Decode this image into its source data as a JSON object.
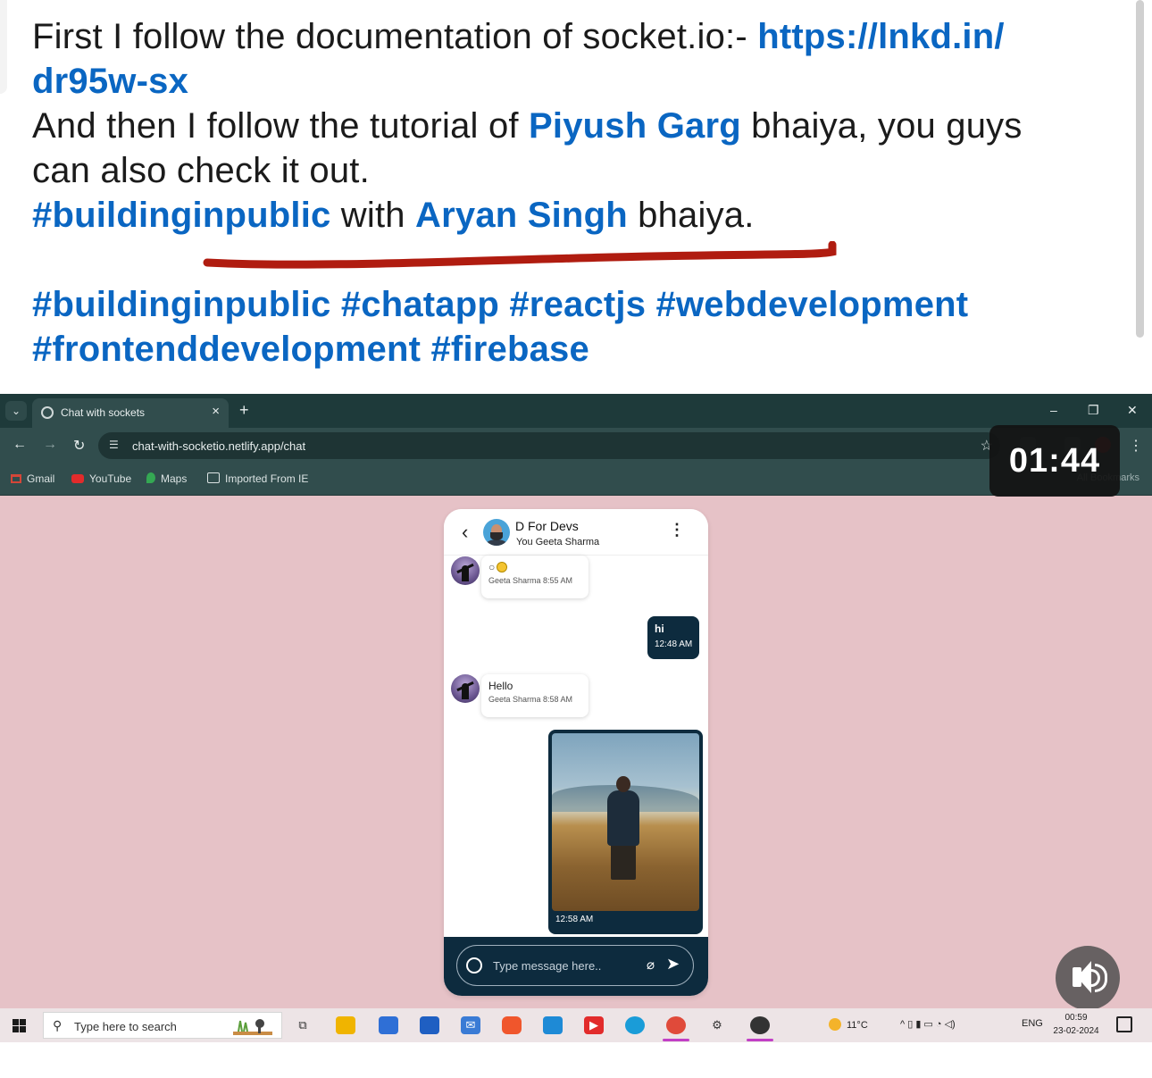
{
  "post": {
    "line1_text": "First I follow the documentation of socket.io:- ",
    "line1_link": "https://lnkd.in/",
    "line2_link": "dr95w-sx",
    "line3_prefix": "And then I follow the tutorial of ",
    "line3_mention": "Piyush Garg",
    "line3_suffix": " bhaiya, you guys",
    "line4_text": "can also check it out.",
    "line5_hashtag": "#buildinginpublic",
    "line5_mid": " with ",
    "line5_mention": "Aryan Singh",
    "line5_suffix": " bhaiya.",
    "hashtags_line1": [
      "#buildinginpublic",
      "#chatapp",
      "#reactjs",
      "#webdevelopment"
    ],
    "hashtags_line2": [
      "#frontenddevelopment",
      "#firebase"
    ],
    "annotation_color": "#b01c10"
  },
  "browser": {
    "tab_title": "Chat with sockets",
    "url": "chat-with-socketio.netlify.app/chat",
    "bookmarks": [
      "Gmail",
      "YouTube",
      "Maps",
      "Imported From IE"
    ],
    "all_bookmarks": "All Bookmarks"
  },
  "video": {
    "timer": "01:44",
    "background_color": "#e6c2c7"
  },
  "chat": {
    "group_name": "D For Devs",
    "members": "You Geeta Sharma",
    "messages": [
      {
        "direction": "in",
        "text": "○",
        "sender": "Geeta Sharma",
        "time": "8:55 AM",
        "meta": "Geeta Sharma 8:55 AM"
      },
      {
        "direction": "out",
        "text": "hi",
        "time": "12:48 AM"
      },
      {
        "direction": "in",
        "text": "Hello",
        "sender": "Geeta Sharma",
        "time": "8:58 AM",
        "meta": "Geeta Sharma 8:58 AM"
      },
      {
        "direction": "out",
        "type": "image",
        "time": "12:58 AM"
      }
    ],
    "input_placeholder": "Type message here..",
    "accent_color": "#0d2b3e"
  },
  "taskbar": {
    "search_placeholder": "Type here to search",
    "weather": "11°C",
    "language": "ENG",
    "time": "00:59",
    "date": "23-02-2024"
  }
}
